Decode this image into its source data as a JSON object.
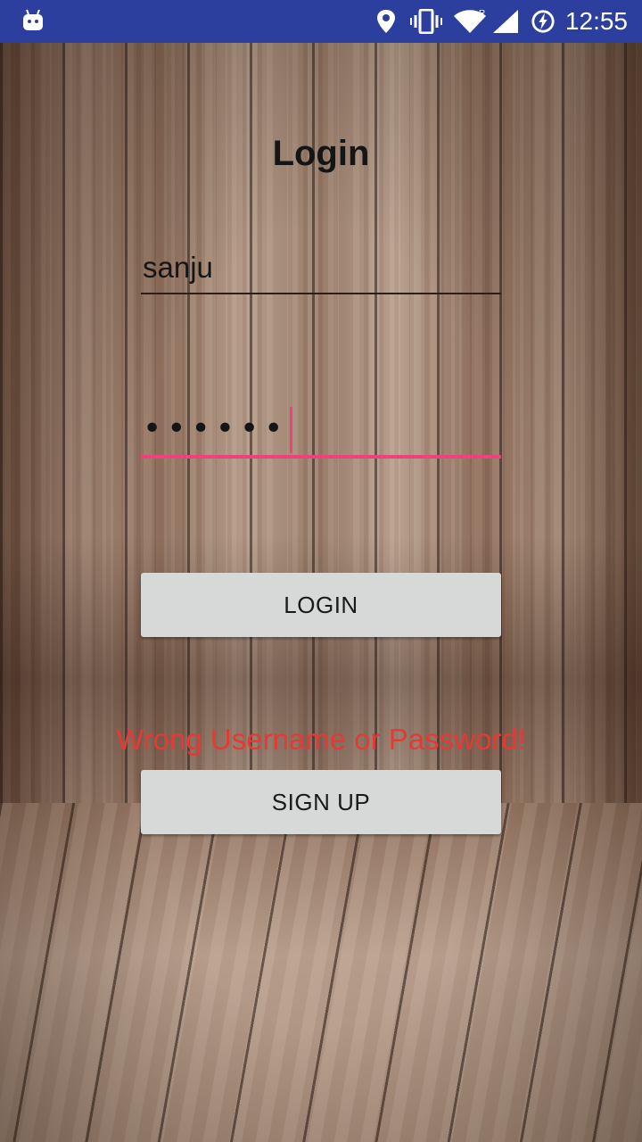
{
  "status_bar": {
    "time": "12:55",
    "icons": [
      "android-icon",
      "location-icon",
      "vibrate-icon",
      "wifi-icon",
      "signal-icon",
      "battery-charging-icon"
    ],
    "background": "#2d3f9e"
  },
  "login_screen": {
    "title": "Login",
    "username_value": "sanju",
    "password_mask": "••••••",
    "login_button_label": "LOGIN",
    "error_message": "Wrong Username or Password!",
    "signup_button_label": "SIGN UP"
  },
  "colors": {
    "accent": "#f0417a",
    "error": "#e53935",
    "button": "#d7d8d8"
  }
}
